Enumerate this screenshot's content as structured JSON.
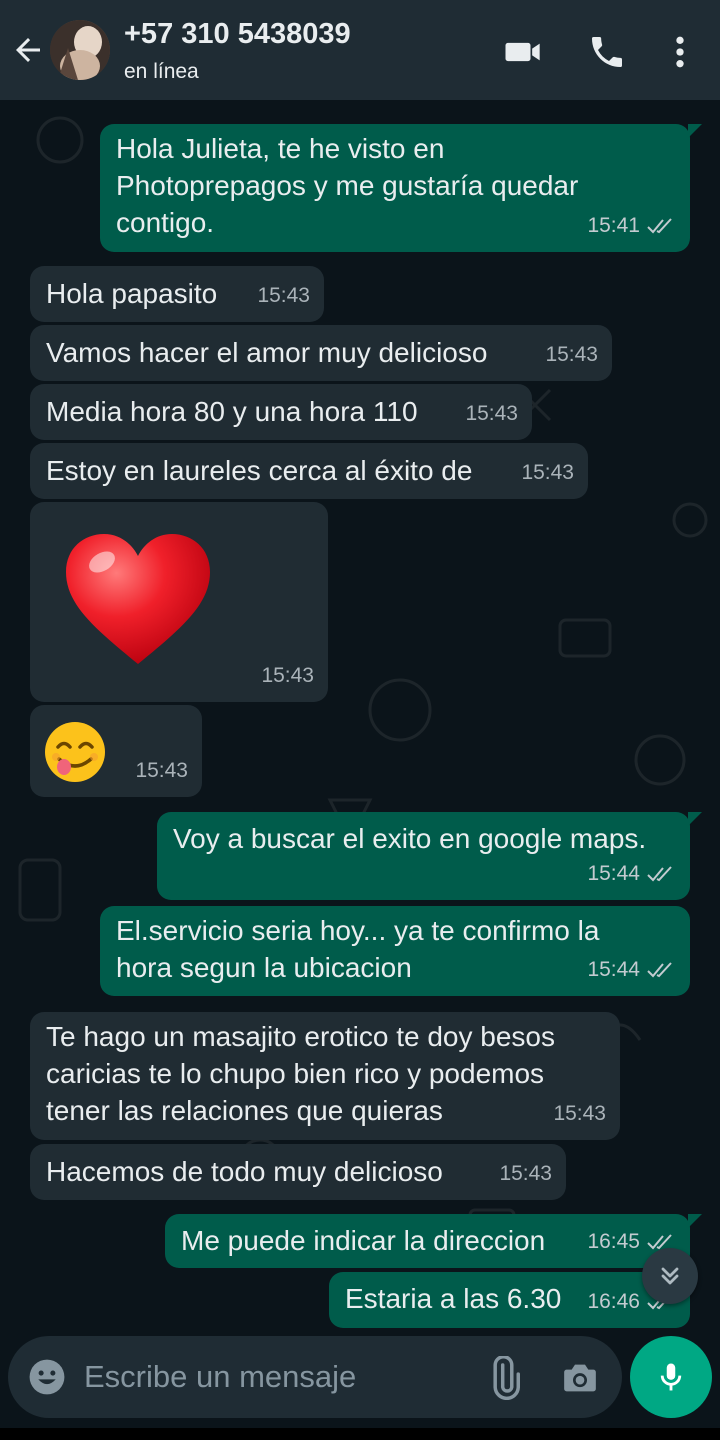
{
  "header": {
    "contact_name": "+57 310 5438039",
    "status": "en línea",
    "icons": [
      "back-arrow-icon",
      "video-call-icon",
      "phone-call-icon",
      "more-options-icon"
    ]
  },
  "messages": [
    {
      "direction": "out",
      "text": "Hola Julieta, te he visto en\nPhotoprepagos y me gustaría quedar\ncontigo.",
      "time": "15:41",
      "status": "read"
    },
    {
      "direction": "in",
      "text": "Hola papasito",
      "time": "15:43"
    },
    {
      "direction": "in",
      "text": "Vamos hacer el amor muy delicioso",
      "time": "15:43"
    },
    {
      "direction": "in",
      "text": "Media hora 80 y una hora 110",
      "time": "15:43"
    },
    {
      "direction": "in",
      "text": "Estoy en laureles cerca al éxito de",
      "time": "15:43"
    },
    {
      "direction": "in",
      "type": "emoji",
      "emoji": "heart",
      "time": "15:43"
    },
    {
      "direction": "in",
      "type": "emoji",
      "emoji": "face-savoring-food",
      "time": "15:43"
    },
    {
      "direction": "out",
      "text": "Voy a buscar el exito en google maps.",
      "time": "15:44",
      "status": "read"
    },
    {
      "direction": "out",
      "text": "El.servicio seria hoy... ya te confirmo la\nhora segun la ubicacion",
      "time": "15:44",
      "status": "read"
    },
    {
      "direction": "in",
      "text": "Te hago un masajito erotico te doy besos\ncaricias te lo chupo bien rico y podemos\ntener las relaciones que quieras",
      "time": "15:43"
    },
    {
      "direction": "in",
      "text": "Hacemos de todo muy delicioso",
      "time": "15:43"
    },
    {
      "direction": "out",
      "text": "Me puede indicar la direccion",
      "time": "16:45",
      "status": "read"
    },
    {
      "direction": "out",
      "text": "Estaria a las 6.30",
      "time": "16:46",
      "status": "read"
    }
  ],
  "input": {
    "placeholder": "Escribe un mensaje",
    "icons": [
      "emoji-icon",
      "attach-icon",
      "camera-icon",
      "microphone-icon"
    ]
  },
  "colors": {
    "header_bg": "#1f2c34",
    "chat_bg": "#0b141a",
    "incoming_bubble": "#202c33",
    "outgoing_bubble": "#005c4b",
    "accent": "#00a884",
    "read_ticks": "#c3cbd0"
  }
}
